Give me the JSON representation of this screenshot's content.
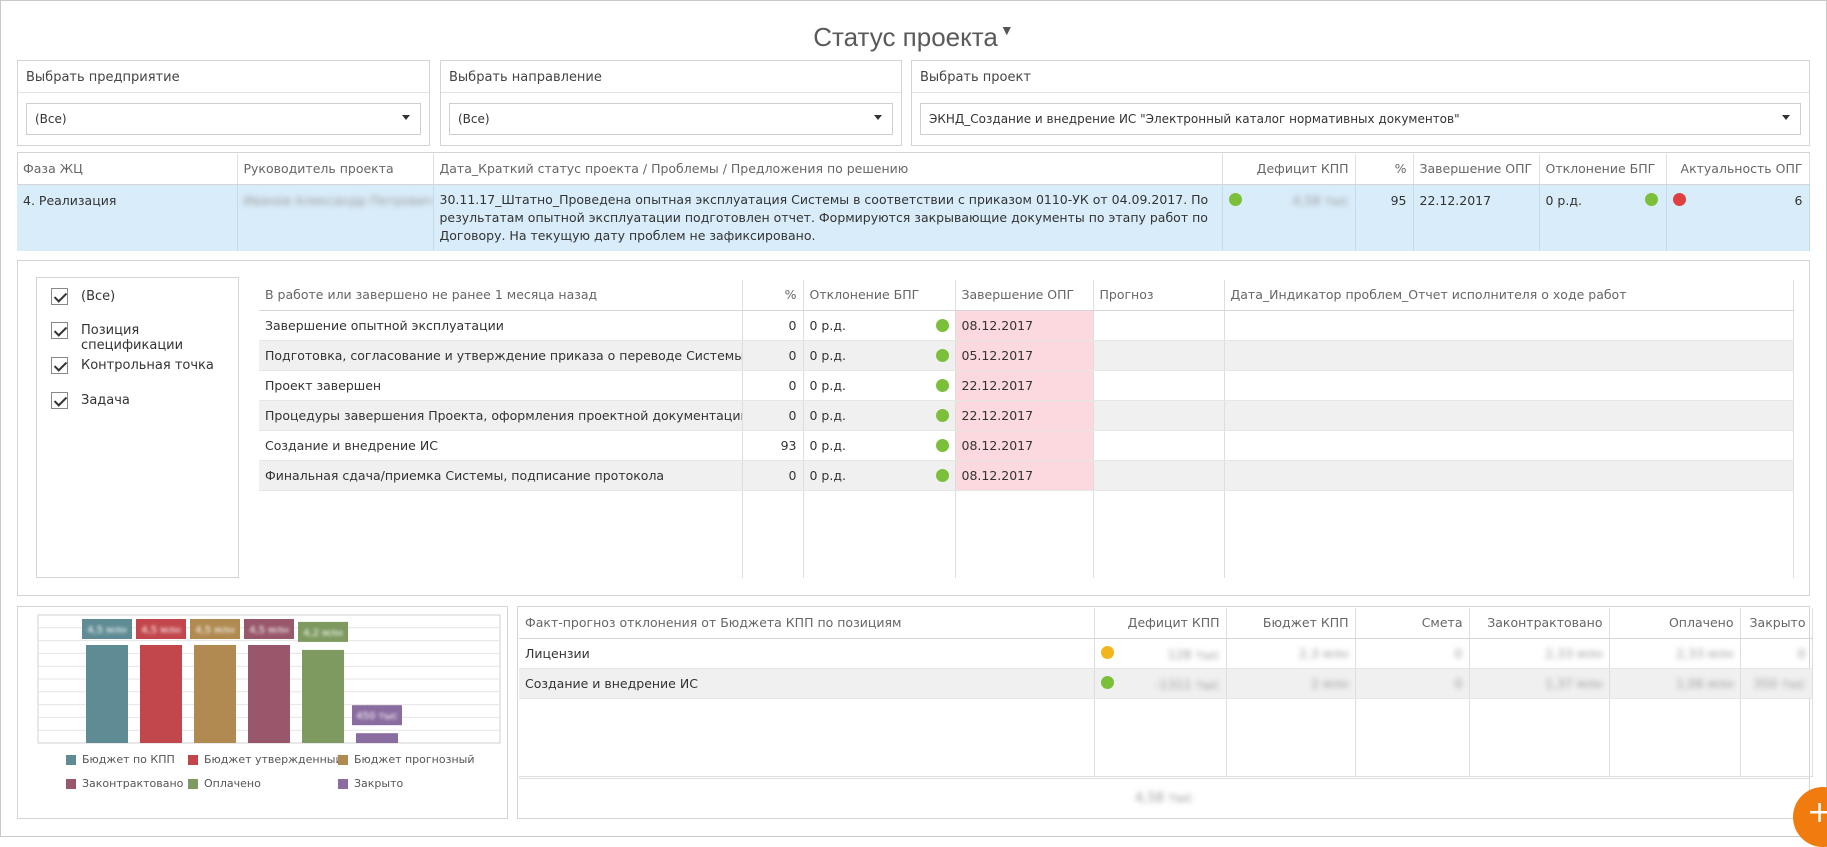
{
  "page_title": "Статус проекта",
  "filters": {
    "enterprise": {
      "label": "Выбрать предприятие",
      "value": "(Все)"
    },
    "direction": {
      "label": "Выбрать направление",
      "value": "(Все)"
    },
    "project": {
      "label": "Выбрать проект",
      "value": "ЭКНД_Создание и внедрение ИС \"Электронный каталог нормативных документов\""
    }
  },
  "status": {
    "headers": [
      "Фаза ЖЦ",
      "Руководитель проекта",
      "Дата_Краткий статус проекта / Проблемы / Предложения по решению",
      "Дефицит КПП",
      "%",
      "Завершение ОПГ",
      "Отклонение БПГ",
      "Актуальность ОПГ"
    ],
    "row": {
      "phase": "4. Реализация",
      "manager": "Иванов Александр Петрович",
      "text": "30.11.17_Штатно_Проведена опытная эксплуатация Системы в соответствии с приказом 0110-УК от 04.09.2017. По результатам опытной эксплуатации подготовлен отчет. Формируются закрывающие документы по этапу работ по Договору. На текущую дату проблем не зафиксировано.",
      "deficit_status": "green",
      "deficit": "4,58 тыс",
      "percent": "95",
      "completion": "22.12.2017",
      "deviation": "0 р.д.",
      "deviation_status": "green",
      "actuality_status": "red",
      "actuality": "6"
    }
  },
  "checkbox_filter": {
    "items": [
      {
        "label": "(Все)",
        "checked": true
      },
      {
        "label": "Позиция спецификации",
        "checked": true
      },
      {
        "label": "Контрольная точка",
        "checked": true
      },
      {
        "label": "Задача",
        "checked": true
      }
    ]
  },
  "tasks": {
    "headers": [
      "В работе или завершено не ранее 1 месяца назад",
      "%",
      "Отклонение БПГ",
      "Завершение ОПГ",
      "Прогноз",
      "Дата_Индикатор проблем_Отчет исполнителя о ходе работ"
    ],
    "rows": [
      {
        "name": "Завершение опытной эксплуатации",
        "pct": "0",
        "dev": "0 р.д.",
        "status": "green",
        "date": "08.12.2017"
      },
      {
        "name": "Подготовка, согласование и утверждение приказа о переводе Системы в ПЭ",
        "pct": "0",
        "dev": "0 р.д.",
        "status": "green",
        "date": "05.12.2017"
      },
      {
        "name": "Проект завершен",
        "pct": "0",
        "dev": "0 р.д.",
        "status": "green",
        "date": "22.12.2017"
      },
      {
        "name": "Процедуры завершения Проекта, оформления проектной документации",
        "pct": "0",
        "dev": "0 р.д.",
        "status": "green",
        "date": "22.12.2017"
      },
      {
        "name": "Создание и внедрение ИС",
        "pct": "93",
        "dev": "0 р.д.",
        "status": "green",
        "date": "08.12.2017"
      },
      {
        "name": "Финальная сдача/приемка Системы, подписание протокола",
        "pct": "0",
        "dev": "0 р.д.",
        "status": "green",
        "date": "08.12.2017"
      }
    ]
  },
  "chart_data": {
    "type": "bar",
    "categories": [
      "Бюджет по КПП",
      "Бюджет утвержденный",
      "Бюджет прогнозный",
      "Законтрактовано",
      "Оплачено",
      "Закрыто"
    ],
    "values": [
      100,
      100,
      100,
      100,
      95,
      10
    ],
    "data_labels": [
      "4,5 млн",
      "4,5 млн",
      "4,5 млн",
      "4,5 млн",
      "4,2 млн",
      "450 тыс"
    ],
    "colors": [
      "#5f8c94",
      "#c2474c",
      "#b08a50",
      "#98576a",
      "#7e9a60",
      "#8a6ca0"
    ],
    "ylim": [
      0,
      100
    ],
    "grid": true,
    "legend": "bottom"
  },
  "budget": {
    "headers": [
      "Факт-прогноз отклонения от Бюджета КПП по позициям",
      "Дефицит КПП",
      "Бюджет КПП",
      "Смета",
      "Законтрактовано",
      "Оплачено",
      "Закрыто"
    ],
    "rows": [
      {
        "name": "Лицензии",
        "status": "yellow",
        "deficit": "128 тыс",
        "budget": "2,3 млн",
        "estimate": "0",
        "contracted": "2,33 млн",
        "paid": "2,33 млн",
        "closed": "0"
      },
      {
        "name": "Создание и внедрение ИС",
        "status": "green",
        "deficit": "-1311 тыс",
        "budget": "2 млн",
        "estimate": "0",
        "contracted": "1,37 млн",
        "paid": "1,06 млн",
        "closed": "350 тыс"
      }
    ],
    "total": "4,58 тыс"
  },
  "fab": {
    "icon": "plus-icon",
    "label": "+"
  }
}
